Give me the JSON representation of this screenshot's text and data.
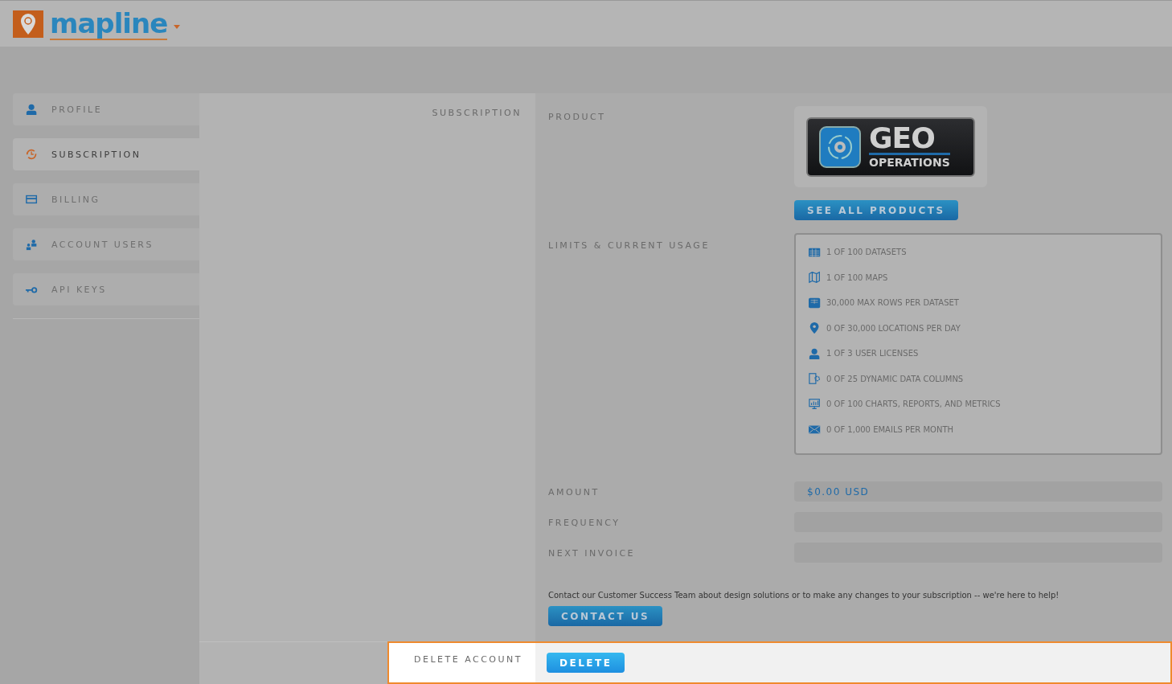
{
  "header": {
    "logo_text": "mapline"
  },
  "sidebar": {
    "items": [
      {
        "label": "PROFILE",
        "kind": "profile",
        "selected": false
      },
      {
        "label": "SUBSCRIPTION",
        "kind": "subscription",
        "selected": true
      },
      {
        "label": "BILLING",
        "kind": "billing",
        "selected": false
      },
      {
        "label": "ACCOUNT USERS",
        "kind": "users",
        "selected": false
      },
      {
        "label": "API KEYS",
        "kind": "key",
        "selected": false
      }
    ]
  },
  "section_title": "SUBSCRIPTION",
  "product": {
    "label": "PRODUCT",
    "logo_title": "GEO",
    "logo_subtitle": "OPERATIONS",
    "button": "SEE ALL PRODUCTS"
  },
  "limits": {
    "label": "LIMITS & CURRENT USAGE",
    "items": [
      {
        "kind": "datasets",
        "text": "1 OF 100 DATASETS"
      },
      {
        "kind": "maps",
        "text": "1 OF 100 MAPS"
      },
      {
        "kind": "rows",
        "text": "30,000 MAX ROWS PER DATASET"
      },
      {
        "kind": "locations",
        "text": "0 OF 30,000 LOCATIONS PER DAY"
      },
      {
        "kind": "users",
        "text": "1 OF 3 USER LICENSES"
      },
      {
        "kind": "columns",
        "text": "0 OF 25 DYNAMIC DATA COLUMNS"
      },
      {
        "kind": "charts",
        "text": "0 OF 100 CHARTS, REPORTS, AND METRICS"
      },
      {
        "kind": "emails",
        "text": "0 OF 1,000 EMAILS PER MONTH"
      }
    ]
  },
  "fields": [
    {
      "label": "AMOUNT",
      "value": "$0.00 USD"
    },
    {
      "label": "FREQUENCY"
    },
    {
      "label": "NEXT INVOICE"
    }
  ],
  "contact": {
    "text": "Contact our Customer Success Team about design solutions or to make any changes to your subscription -- we're here to help!",
    "button": "CONTACT US"
  },
  "delete_account": {
    "label": "DELETE ACCOUNT",
    "button": "DELETE"
  }
}
